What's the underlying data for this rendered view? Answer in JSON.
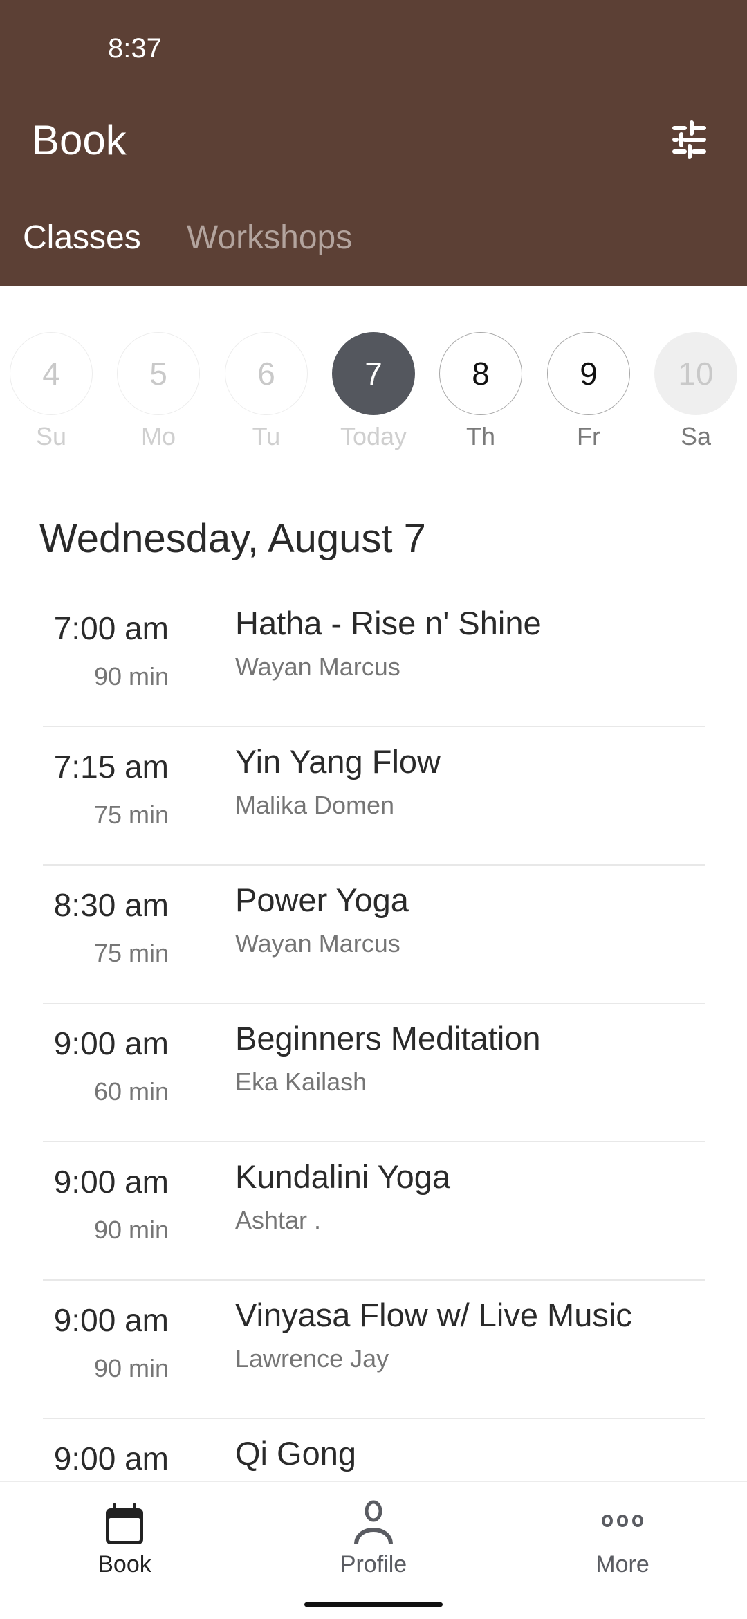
{
  "status_bar": {
    "time": "8:37"
  },
  "header": {
    "title": "Book",
    "filter_icon": "sliders-icon",
    "background_color": "#5c4035"
  },
  "tabs": [
    {
      "label": "Classes",
      "active": true
    },
    {
      "label": "Workshops",
      "active": false
    }
  ],
  "date_strip": [
    {
      "day": "4",
      "label": "Su",
      "state": "past"
    },
    {
      "day": "5",
      "label": "Mo",
      "state": "past"
    },
    {
      "day": "6",
      "label": "Tu",
      "state": "past"
    },
    {
      "day": "7",
      "label": "Today",
      "state": "selected"
    },
    {
      "day": "8",
      "label": "Th",
      "state": "future"
    },
    {
      "day": "9",
      "label": "Fr",
      "state": "future"
    },
    {
      "day": "10",
      "label": "Sa",
      "state": "disabled"
    }
  ],
  "date_heading": "Wednesday, August 7",
  "classes": [
    {
      "time": "7:00 am",
      "duration": "90 min",
      "name": "Hatha - Rise n' Shine",
      "teacher": "Wayan Marcus"
    },
    {
      "time": "7:15 am",
      "duration": "75 min",
      "name": "Yin Yang Flow",
      "teacher": "Malika Domen"
    },
    {
      "time": "8:30 am",
      "duration": "75 min",
      "name": "Power Yoga",
      "teacher": "Wayan Marcus"
    },
    {
      "time": "9:00 am",
      "duration": "60 min",
      "name": "Beginners Meditation",
      "teacher": "Eka Kailash"
    },
    {
      "time": "9:00 am",
      "duration": "90 min",
      "name": "Kundalini Yoga",
      "teacher": "Ashtar ."
    },
    {
      "time": "9:00 am",
      "duration": "90 min",
      "name": "Vinyasa Flow w/ Live Music",
      "teacher": "Lawrence Jay"
    },
    {
      "time": "9:00 am",
      "duration": "",
      "name": "Qi Gong",
      "teacher": ""
    }
  ],
  "bottom_nav": [
    {
      "label": "Book",
      "icon": "calendar-icon",
      "active": true
    },
    {
      "label": "Profile",
      "icon": "person-icon",
      "active": false
    },
    {
      "label": "More",
      "icon": "more-dots-icon",
      "active": false
    }
  ]
}
